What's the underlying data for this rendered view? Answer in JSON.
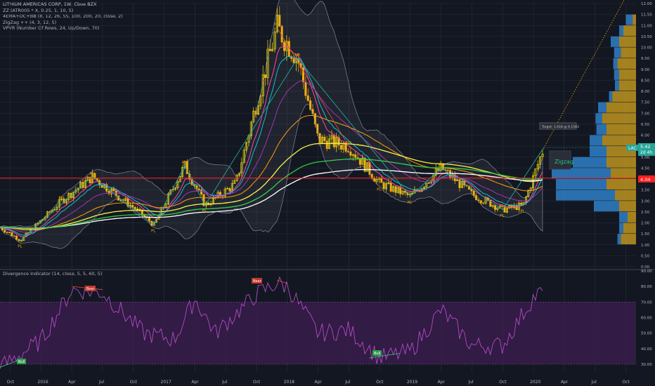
{
  "main_legend": {
    "title": "LITHIUM AMERICAS CORP, 1W, Cboe BZX",
    "lines": [
      "ZZ (ATR005 * X, 0.25, 1, 10, 5)",
      "4EMA+DC+BB (8, 12, 26, 55, 100, 200, 20, close, 2)",
      "ZigZag ++ (4, 3, 12, 5)",
      "VPVR (Number Of Rows, 24, Up/Down, 70)"
    ]
  },
  "osc_legend": {
    "title": "Divergence Indicator (14, close, 5, 5, 60, 5)"
  },
  "labels": {
    "ticker": "LAC",
    "last_price": "5.42",
    "countdown": "2d 4h",
    "ref_price": "4.04",
    "zigzag": "Zigzag",
    "target": "Target: 1.618 @ 6.1583",
    "bear": "Bear",
    "bull": "Bull",
    "ph": "PH",
    "pl": "PL"
  },
  "colors": {
    "background": "#131722",
    "grid": "#2a2e39",
    "candle_up": "#f5e400",
    "candle_down": "#f2a900",
    "ema8": "#ff3b9a",
    "ema12": "#00bcd4",
    "ema26": "#9c27b0",
    "ema55": "#ff9800",
    "ema100": "#f5f542",
    "ema200": "#ffffff",
    "sma": "#2ecc40",
    "zigzag": "#26a69a",
    "ref_line": "#ff1f1f",
    "vp_up": "#2f80c8",
    "vp_down": "#d6a51f",
    "osc": "#b14bc4",
    "osc_band": "#3b1d4f",
    "lac_badge": "#26a69a"
  },
  "chart_data": [
    {
      "type": "candlestick",
      "name": "price",
      "y_axis": {
        "min": 0,
        "max": 12,
        "ticks": [
          "0.00",
          "0.50",
          "1.00",
          "1.50",
          "2.00",
          "2.50",
          "3.00",
          "3.50",
          "4.00",
          "4.50",
          "5.00",
          "5.50",
          "6.00",
          "6.50",
          "7.00",
          "7.50",
          "8.00",
          "8.50",
          "9.00",
          "9.50",
          "10.00",
          "10.50",
          "11.00",
          "11.50",
          "12.00"
        ]
      },
      "x_axis": {
        "ticks": [
          "Oct",
          "2016",
          "Apr",
          "Jul",
          "Oct",
          "2017",
          "Apr",
          "Jul",
          "Oct",
          "2018",
          "Apr",
          "Jul",
          "Oct",
          "2019",
          "Apr",
          "Jul",
          "Oct",
          "2020",
          "Apr",
          "Jul",
          "Oct"
        ]
      },
      "key_points": [
        {
          "date": "2015-09",
          "price": 1.8
        },
        {
          "date": "2015-11",
          "price": 1.2
        },
        {
          "date": "2016-03",
          "price": 3.0
        },
        {
          "date": "2016-06",
          "price": 4.1
        },
        {
          "date": "2016-10",
          "price": 2.7
        },
        {
          "date": "2016-12",
          "price": 1.9
        },
        {
          "date": "2017-03",
          "price": 4.6
        },
        {
          "date": "2017-05",
          "price": 2.8
        },
        {
          "date": "2017-08",
          "price": 3.8
        },
        {
          "date": "2017-10",
          "price": 7.5
        },
        {
          "date": "2017-12",
          "price": 10.9
        },
        {
          "date": "2018-02",
          "price": 9.5
        },
        {
          "date": "2018-04",
          "price": 5.8
        },
        {
          "date": "2018-07",
          "price": 5.5
        },
        {
          "date": "2018-10",
          "price": 3.8
        },
        {
          "date": "2019-01",
          "price": 3.2
        },
        {
          "date": "2019-04",
          "price": 4.5
        },
        {
          "date": "2019-07",
          "price": 3.3
        },
        {
          "date": "2019-10",
          "price": 2.6
        },
        {
          "date": "2019-12",
          "price": 2.8
        },
        {
          "date": "2020-01",
          "price": 4.1
        },
        {
          "date": "2020-02",
          "price": 5.42
        }
      ],
      "reference_line": 4.04,
      "last_price": 5.42,
      "target": 6.1583
    },
    {
      "type": "line",
      "name": "Divergence Indicator",
      "y_axis": {
        "min": 25,
        "max": 90,
        "ticks": [
          "30.00",
          "40.00",
          "50.00",
          "60.00",
          "70.00",
          "80.00",
          "90.00"
        ]
      },
      "band": [
        30,
        70
      ],
      "key_points": [
        {
          "date": "2015-09",
          "value": 28
        },
        {
          "date": "2016-01",
          "value": 45
        },
        {
          "date": "2016-04",
          "value": 78
        },
        {
          "date": "2016-07",
          "value": 76
        },
        {
          "date": "2016-11",
          "value": 50
        },
        {
          "date": "2017-02",
          "value": 46
        },
        {
          "date": "2017-04",
          "value": 72
        },
        {
          "date": "2017-06",
          "value": 50
        },
        {
          "date": "2017-10",
          "value": 75
        },
        {
          "date": "2017-12",
          "value": 82
        },
        {
          "date": "2018-01",
          "value": 80
        },
        {
          "date": "2018-04",
          "value": 50
        },
        {
          "date": "2018-07",
          "value": 52
        },
        {
          "date": "2018-10",
          "value": 34
        },
        {
          "date": "2019-01",
          "value": 38
        },
        {
          "date": "2019-04",
          "value": 65
        },
        {
          "date": "2019-07",
          "value": 42
        },
        {
          "date": "2019-10",
          "value": 42
        },
        {
          "date": "2020-01",
          "value": 73
        },
        {
          "date": "2020-02",
          "value": 77
        }
      ]
    }
  ]
}
